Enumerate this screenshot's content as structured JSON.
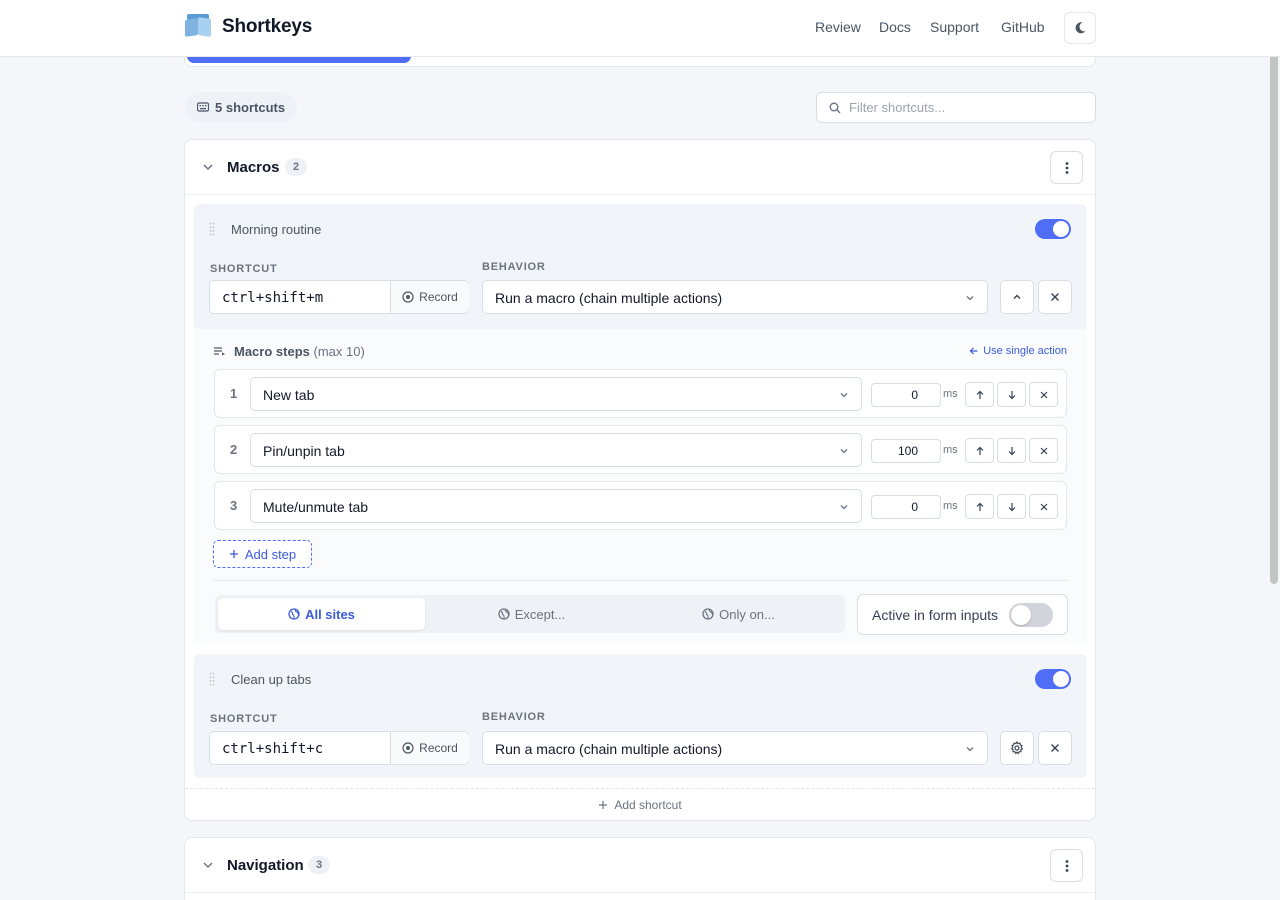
{
  "app": {
    "brand": "Shortkeys",
    "nav": [
      "Review",
      "Docs",
      "Support",
      "GitHub"
    ],
    "theme_icon": "moon-icon"
  },
  "toolbar": {
    "count_label": "5 shortcuts",
    "filter_placeholder": "Filter shortcuts..."
  },
  "groups": [
    {
      "title": "Macros",
      "count": "2",
      "shortcuts": [
        {
          "name": "Morning routine",
          "enabled": true,
          "shortcut_label": "SHORTCUT",
          "behavior_label": "BEHAVIOR",
          "keys": "ctrl+shift+m",
          "record_label": "Record",
          "behavior": "Run a macro (chain multiple actions)",
          "macro": {
            "title": "Macro steps",
            "limit": "(max 10)",
            "use_single": "Use single action",
            "steps": [
              {
                "n": "1",
                "action": "New tab",
                "delay": "0"
              },
              {
                "n": "2",
                "action": "Pin/unpin tab",
                "delay": "100"
              },
              {
                "n": "3",
                "action": "Mute/unmute tab",
                "delay": "0"
              }
            ],
            "delay_unit": "ms",
            "add_step": "Add step",
            "scope": [
              "All sites",
              "Except...",
              "Only on..."
            ],
            "scope_active": "All sites",
            "form_inputs_label": "Active in form inputs",
            "form_inputs_enabled": false
          }
        },
        {
          "name": "Clean up tabs",
          "enabled": true,
          "shortcut_label": "SHORTCUT",
          "behavior_label": "BEHAVIOR",
          "keys": "ctrl+shift+c",
          "record_label": "Record",
          "behavior": "Run a macro (chain multiple actions)"
        }
      ],
      "add_shortcut": "Add shortcut"
    },
    {
      "title": "Navigation",
      "count": "3"
    }
  ],
  "colors": {
    "accent": "#4f6df5",
    "link": "#3b5bdb"
  }
}
